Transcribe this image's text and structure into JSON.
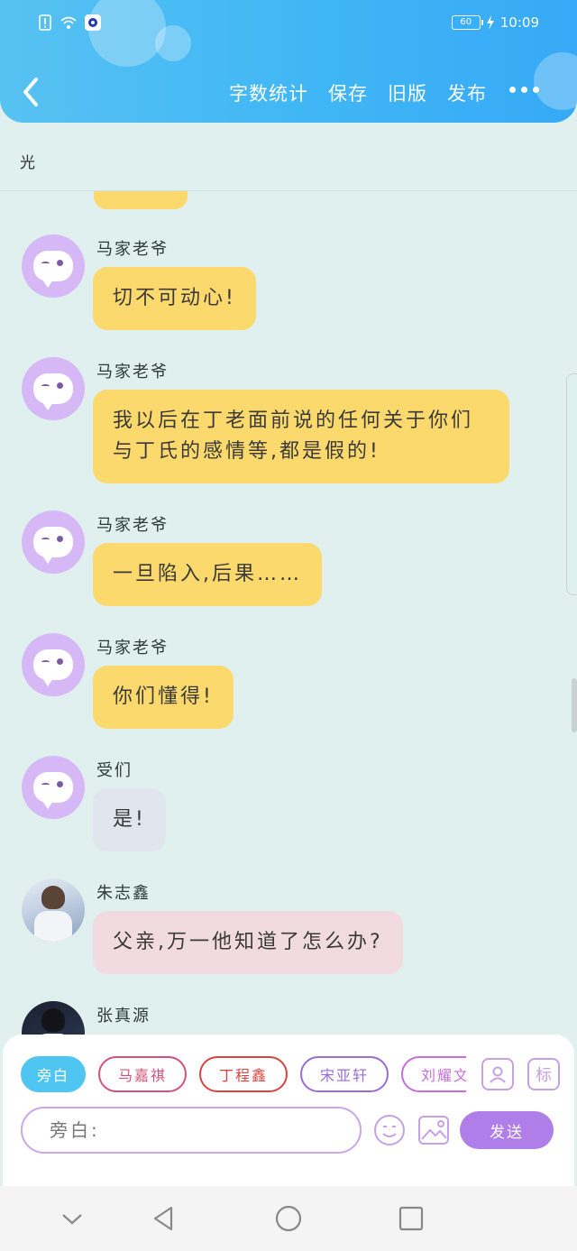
{
  "status_bar": {
    "battery": "60",
    "time": "10:09"
  },
  "header": {
    "actions": [
      "字数统计",
      "保存",
      "旧版",
      "发布"
    ],
    "more": "•••"
  },
  "title": "光",
  "messages": [
    {
      "name": "马家老爷",
      "text": "切不可动心!",
      "style": "yellow",
      "avatar": "cartoon"
    },
    {
      "name": "马家老爷",
      "text": "我以后在丁老面前说的任何关于你们与丁氏的感情等,都是假的!",
      "style": "yellow",
      "avatar": "cartoon"
    },
    {
      "name": "马家老爷",
      "text": "一旦陷入,后果……",
      "style": "yellow",
      "avatar": "cartoon"
    },
    {
      "name": "马家老爷",
      "text": "你们懂得!",
      "style": "yellow",
      "avatar": "cartoon"
    },
    {
      "name": "受们",
      "text": "是!",
      "style": "gray",
      "avatar": "cartoon"
    },
    {
      "name": "朱志鑫",
      "text": "父亲,万一他知道了怎么办?",
      "style": "pink",
      "avatar": "photo"
    },
    {
      "name": "张真源",
      "text": "",
      "style": "none",
      "avatar": "photo-dark"
    }
  ],
  "panel": {
    "chips": [
      {
        "label": "旁白",
        "color": "#4fc6f2",
        "active": true
      },
      {
        "label": "马嘉祺",
        "color": "#d4527a",
        "active": false
      },
      {
        "label": "丁程鑫",
        "color": "#d9443e",
        "active": false
      },
      {
        "label": "宋亚轩",
        "color": "#9b6cd9",
        "active": false
      },
      {
        "label": "刘耀文",
        "color": "#c86ee0",
        "active": false
      }
    ],
    "tag_button": "标",
    "input_placeholder": "旁白:",
    "send": "发送"
  }
}
